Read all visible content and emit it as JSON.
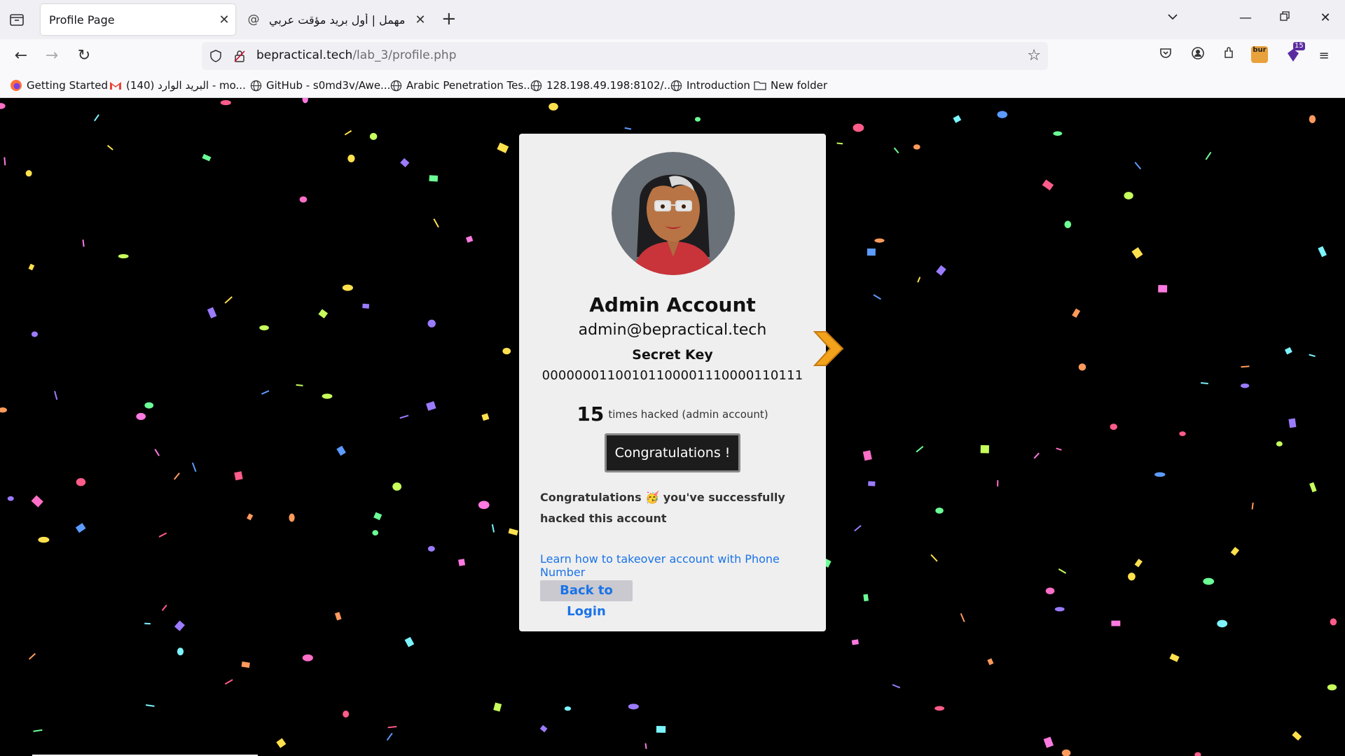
{
  "browser": {
    "tabs": [
      {
        "title": "Profile Page",
        "active": true
      },
      {
        "title": "مهمل | أول بريد مؤقت عربي",
        "active": false
      }
    ],
    "url": {
      "host": "bepractical.tech",
      "path": "/lab_3/profile.php"
    },
    "extension_badge": "15",
    "extension_label": "bur",
    "bookmarks": [
      {
        "label": "Getting Started",
        "icon": "firefox-icon"
      },
      {
        "label": "البريد الوارد (140) - mo...",
        "icon": "gmail-icon"
      },
      {
        "label": "GitHub - s0md3v/Awe...",
        "icon": "globe-icon"
      },
      {
        "label": "Arabic Penetration Tes...",
        "icon": "globe-icon"
      },
      {
        "label": "128.198.49.198:8102/...",
        "icon": "globe-icon"
      },
      {
        "label": "Introduction",
        "icon": "globe-icon"
      },
      {
        "label": "New folder",
        "icon": "folder-icon"
      }
    ]
  },
  "profile": {
    "name": "Admin Account",
    "email": "admin@bepractical.tech",
    "secret_key_label": "Secret Key",
    "secret_key": "00000001100101100001110000110111",
    "hacked_count": "15",
    "hacked_text": "times hacked (admin account)",
    "congrats_button": "Congratulations !",
    "message_prefix": "Congratulations",
    "message_emoji": "🥳",
    "message_suffix": "you've successfully hacked this account",
    "learn_link": "Learn how to takeover account with Phone Number",
    "back_button": "Back to Login"
  },
  "colors": {
    "background": "#000000",
    "card": "#efefef",
    "link": "#1a73e8",
    "button_dark": "#1c1c1c"
  }
}
